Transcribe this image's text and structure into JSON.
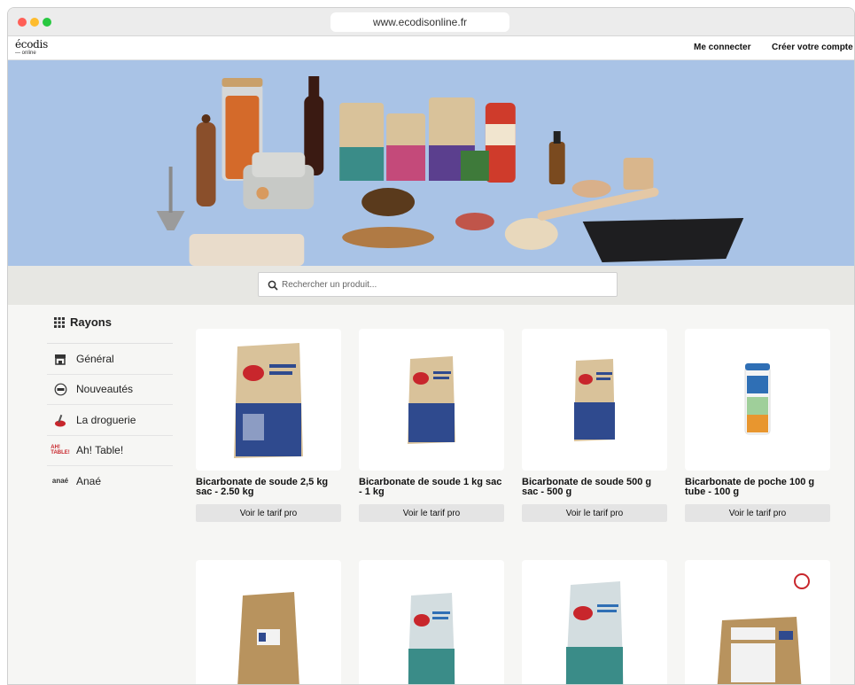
{
  "browser": {
    "url": "www.ecodisonline.fr"
  },
  "header": {
    "logo_main": "écodis",
    "logo_sub": "— online",
    "login": "Me connecter",
    "signup": "Créer votre compte"
  },
  "search": {
    "placeholder": "Rechercher un produit..."
  },
  "sidebar": {
    "title": "Rayons",
    "items": [
      {
        "label": "Général",
        "icon": "store-icon"
      },
      {
        "label": "Nouveautés",
        "icon": "new-badge-icon"
      },
      {
        "label": "La droguerie",
        "icon": "droguerie-logo-icon"
      },
      {
        "label": "Ah! Table!",
        "icon": "ah-table-logo-icon",
        "icon_text": "AH! TABLE!"
      },
      {
        "label": "Anaé",
        "icon": "anae-logo-icon",
        "icon_text": "anaé"
      }
    ]
  },
  "products": [
    {
      "name": "Bicarbonate de soude 2,5 kg sac - 2.50 kg",
      "button": "Voir le tarif pro"
    },
    {
      "name": "Bicarbonate de soude 1 kg sac - 1 kg",
      "button": "Voir le tarif pro"
    },
    {
      "name": "Bicarbonate de soude 500 g sac - 500 g",
      "button": "Voir le tarif pro"
    },
    {
      "name": "Bicarbonate de poche 100 g tube - 100 g",
      "button": "Voir le tarif pro"
    }
  ],
  "colors": {
    "hero_bg": "#a9c3e6",
    "band_bg": "#e7e7e3",
    "button_bg": "#e4e4e4",
    "bag_kraft": "#d9c29a",
    "bag_blue": "#2f4a8e",
    "bag_teal": "#3a8c88"
  }
}
